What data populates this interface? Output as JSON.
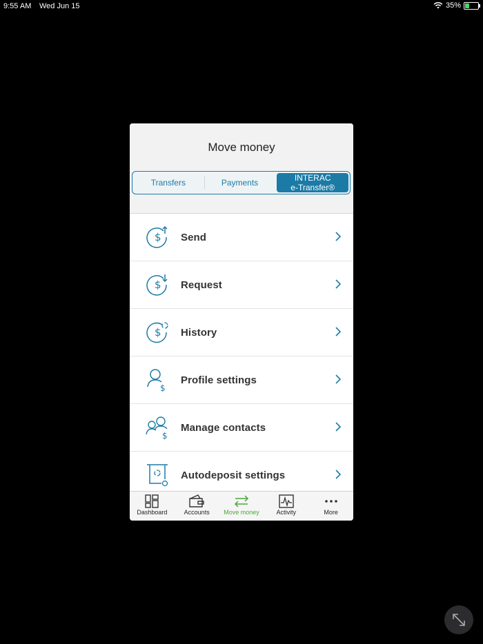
{
  "status_bar": {
    "time": "9:55 AM",
    "date": "Wed Jun 15",
    "battery_percent": "35%",
    "battery_level": 0.35
  },
  "modal": {
    "title": "Move money",
    "tabs": [
      {
        "label": "Transfers",
        "active": false
      },
      {
        "label": "Payments",
        "active": false
      },
      {
        "label_line1": "INTERAC",
        "label_line2": "e-Transfer®",
        "active": true
      }
    ],
    "items": [
      {
        "label": "Send",
        "icon": "dollar-send-icon"
      },
      {
        "label": "Request",
        "icon": "dollar-request-icon"
      },
      {
        "label": "History",
        "icon": "dollar-history-icon"
      },
      {
        "label": "Profile settings",
        "icon": "profile-dollar-icon"
      },
      {
        "label": "Manage contacts",
        "icon": "contacts-dollar-icon"
      },
      {
        "label": "Autodeposit settings",
        "icon": "autodeposit-icon"
      }
    ]
  },
  "tab_bar": {
    "items": [
      {
        "label": "Dashboard",
        "icon": "dashboard-icon"
      },
      {
        "label": "Accounts",
        "icon": "wallet-icon"
      },
      {
        "label": "Move money",
        "icon": "transfer-arrows-icon",
        "active": true
      },
      {
        "label": "Activity",
        "icon": "activity-chart-icon"
      },
      {
        "label": "More",
        "icon": "more-dots-icon"
      }
    ]
  },
  "colors": {
    "accent": "#1b7ba6",
    "active_tab": "#4aa83a",
    "background": "#000000"
  }
}
